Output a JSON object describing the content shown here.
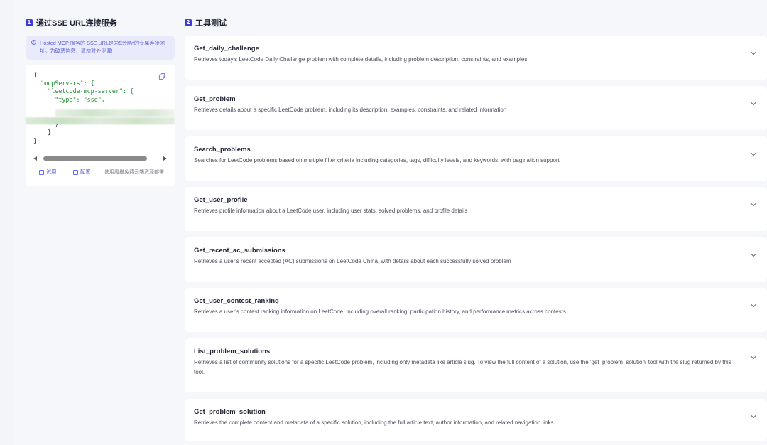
{
  "left": {
    "badge": "1",
    "title": "通过SSE URL连接服务",
    "notice": "Hosted MCP 服务的 SSE URL是为您分配的专属连接地址。为破惩信息，请勿对外泄漏!",
    "code": {
      "l1": "{",
      "l2k": "  \"mcpServers\": {",
      "l3k": "    \"leetcode-mcp-server\": {",
      "l4k": "      \"type\": ",
      "l4v": "\"sse\",",
      "l5": "      }",
      "l6": "    }",
      "l7": "}"
    },
    "actions": {
      "try": "试用",
      "config": "配置",
      "note": "使用魔搭免费云端资源部署"
    }
  },
  "right": {
    "badge": "2",
    "title": "工具测试",
    "tools": [
      {
        "name": "Get_daily_challenge",
        "desc": "Retrieves today's LeetCode Daily Challenge problem with complete details, including problem description, constraints, and examples"
      },
      {
        "name": "Get_problem",
        "desc": "Retrieves details about a specific LeetCode problem, including its description, examples, constraints, and related information"
      },
      {
        "name": "Search_problems",
        "desc": "Searches for LeetCode problems based on multiple filter criteria including categories, tags, difficulty levels, and keywords, with pagination support"
      },
      {
        "name": "Get_user_profile",
        "desc": "Retrieves profile information about a LeetCode user, including user stats, solved problems, and profile details"
      },
      {
        "name": "Get_recent_ac_submissions",
        "desc": "Retrieves a user's recent accepted (AC) submissions on LeetCode China, with details about each successfully solved problem"
      },
      {
        "name": "Get_user_contest_ranking",
        "desc": "Retrieves a user's contest ranking information on LeetCode, including overall ranking, participation history, and performance metrics across contests"
      },
      {
        "name": "List_problem_solutions",
        "desc": "Retrieves a list of community solutions for a specific LeetCode problem, including only metadata like article slug. To view the full content of a solution, use the 'get_problem_solution' tool with the slug returned by this tool."
      },
      {
        "name": "Get_problem_solution",
        "desc": "Retrieves the complete content and metadata of a specific solution, including the full article text, author information, and related navigation links"
      }
    ]
  },
  "colors": {
    "accent": "#3b3dd6",
    "noticeBg": "#e9eafc",
    "codeString": "#1f8a2e"
  }
}
